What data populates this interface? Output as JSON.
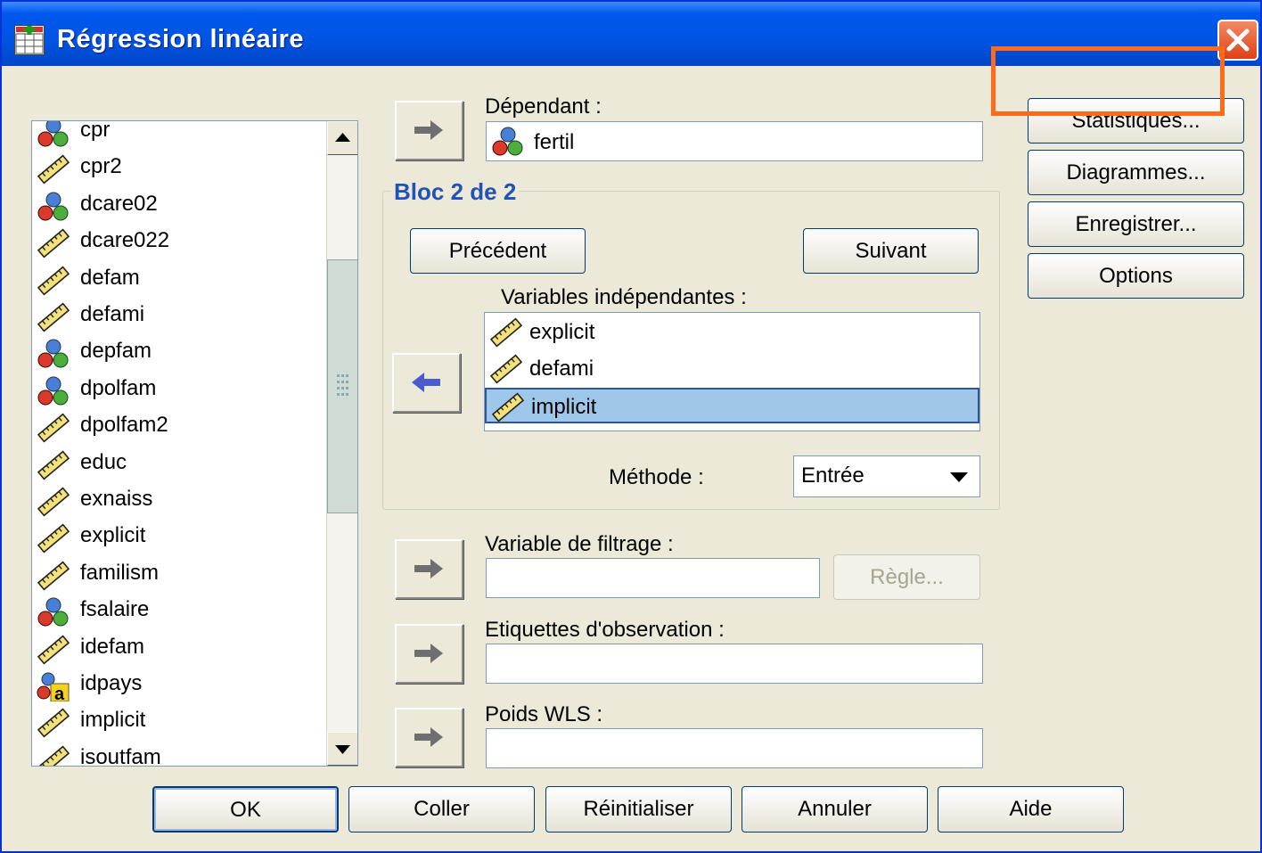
{
  "window": {
    "title": "Régression linéaire"
  },
  "variables": [
    {
      "name": "cpr",
      "type": "nominal"
    },
    {
      "name": "cpr2",
      "type": "scale"
    },
    {
      "name": "dcare02",
      "type": "nominal"
    },
    {
      "name": "dcare022",
      "type": "scale"
    },
    {
      "name": "defam",
      "type": "scale"
    },
    {
      "name": "defami",
      "type": "scale"
    },
    {
      "name": "depfam",
      "type": "nominal"
    },
    {
      "name": "dpolfam",
      "type": "nominal"
    },
    {
      "name": "dpolfam2",
      "type": "scale"
    },
    {
      "name": "educ",
      "type": "scale"
    },
    {
      "name": "exnaiss",
      "type": "scale"
    },
    {
      "name": "explicit",
      "type": "scale"
    },
    {
      "name": "familism",
      "type": "scale"
    },
    {
      "name": "fsalaire",
      "type": "nominal"
    },
    {
      "name": "idefam",
      "type": "scale"
    },
    {
      "name": "idpays",
      "type": "string"
    },
    {
      "name": "implicit",
      "type": "scale"
    },
    {
      "name": "isoutfam",
      "type": "scale"
    }
  ],
  "dependent": {
    "label": "Dépendant :",
    "value": "fertil",
    "type": "nominal"
  },
  "block": {
    "title": "Bloc 2 de 2",
    "previous_label": "Précédent",
    "next_label": "Suivant"
  },
  "independents": {
    "label": "Variables indépendantes :",
    "items": [
      {
        "name": "explicit",
        "type": "scale"
      },
      {
        "name": "defami",
        "type": "scale"
      },
      {
        "name": "implicit",
        "type": "scale",
        "selected": true
      }
    ]
  },
  "method": {
    "label": "Méthode :",
    "value": "Entrée"
  },
  "filter": {
    "label": "Variable de filtrage :",
    "value": "",
    "rule_label": "Règle..."
  },
  "case_labels": {
    "label": "Etiquettes d'observation :",
    "value": ""
  },
  "wls": {
    "label": "Poids WLS :",
    "value": ""
  },
  "side_buttons": {
    "statistics": "Statistiques...",
    "plots": "Diagrammes...",
    "save": "Enregistrer...",
    "options": "Options"
  },
  "bottom_buttons": {
    "ok": "OK",
    "paste": "Coller",
    "reset": "Réinitialiser",
    "cancel": "Annuler",
    "help": "Aide"
  },
  "colors": {
    "titlebar": "#0054e3",
    "highlight": "#ff6b1a",
    "selection": "#9fc7ea",
    "group_title": "#2152b5"
  }
}
